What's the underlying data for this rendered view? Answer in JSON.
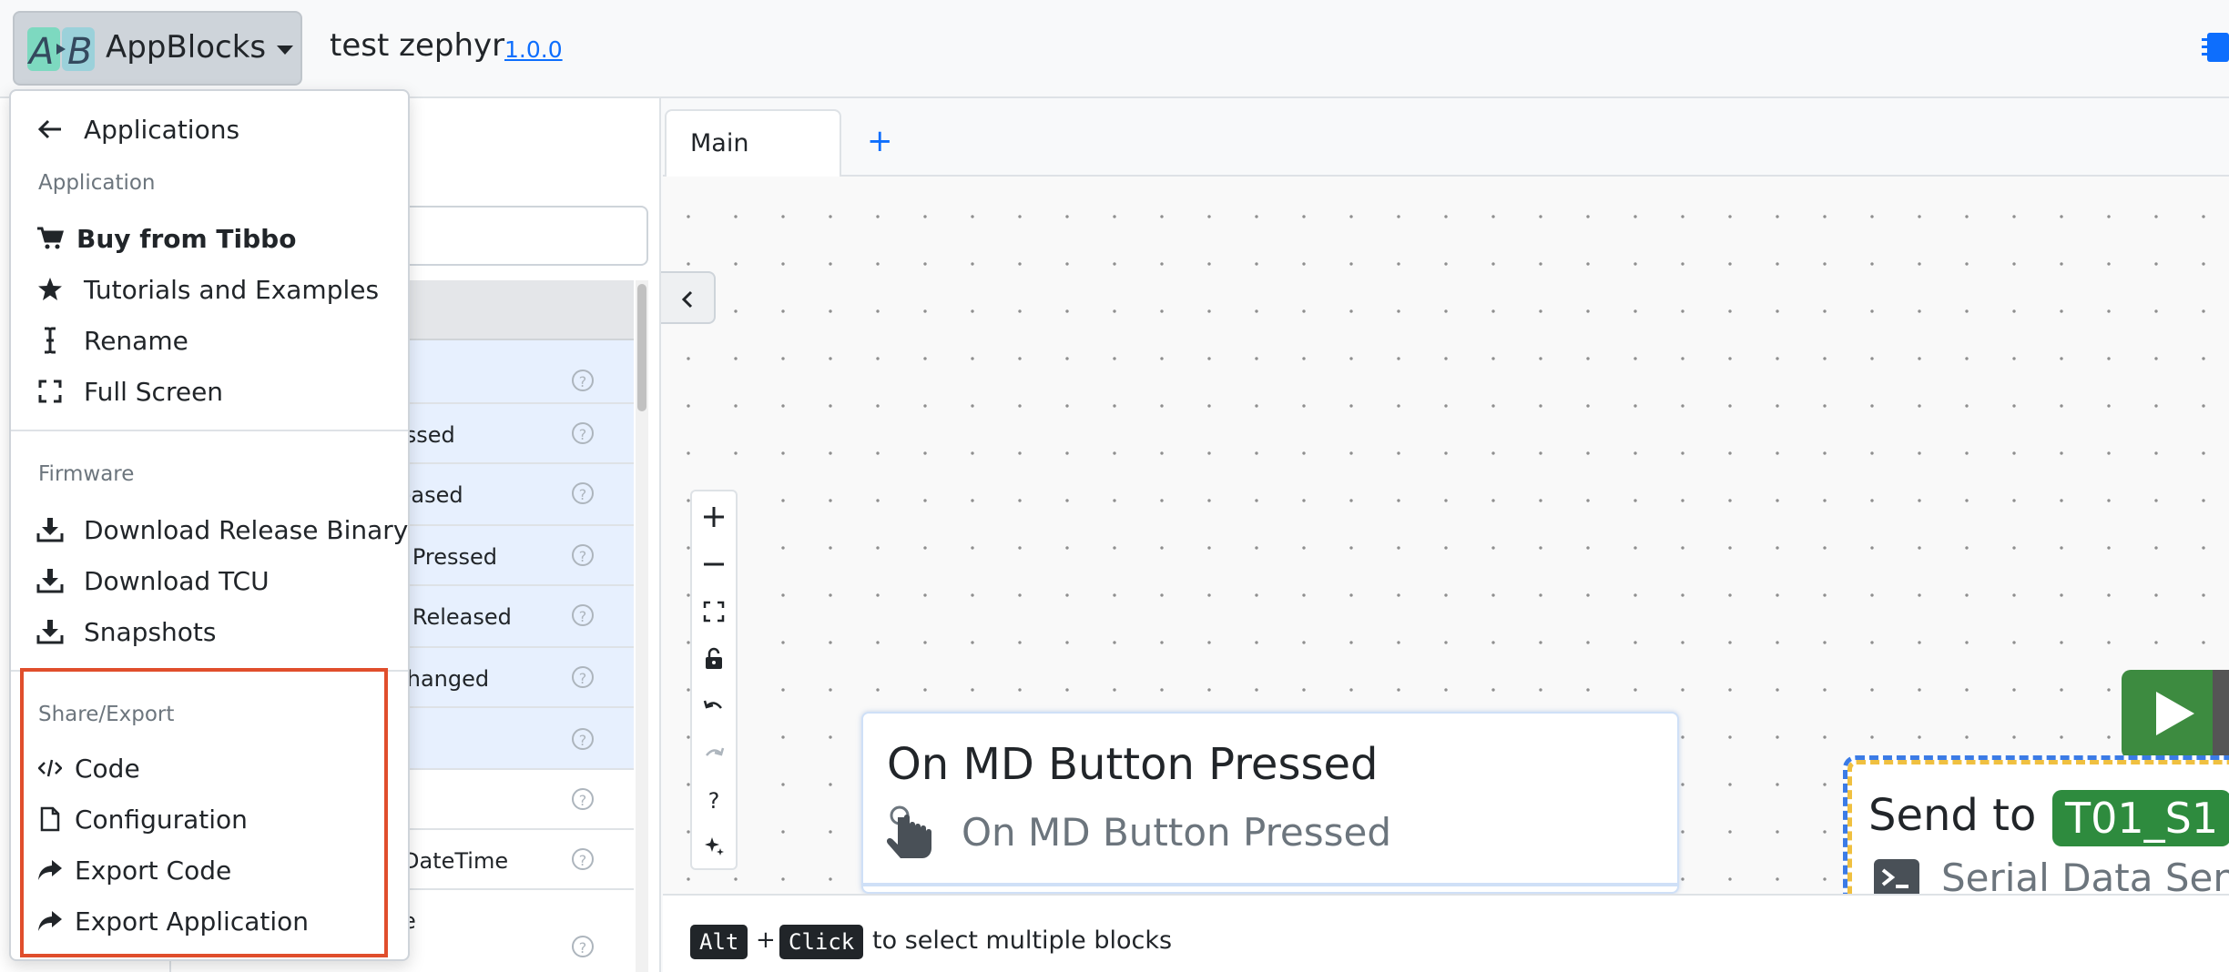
{
  "header": {
    "brand_label": "AppBlocks",
    "logo_text": "AB",
    "app_title": "test zephyr",
    "app_version": "1.0.0"
  },
  "menu": {
    "applications": "Applications",
    "application_section": "Application",
    "buy": "Buy from Tibbo",
    "tutorials": "Tutorials and Examples",
    "rename": "Rename",
    "fullscreen": "Full Screen",
    "firmware_section": "Firmware",
    "download_release": "Download Release Binary",
    "download_tcu": "Download TCU",
    "snapshots": "Snapshots",
    "share_section": "Share/Export",
    "code": "Code",
    "configuration": "Configuration",
    "export_code": "Export Code",
    "export_application": "Export Application"
  },
  "block_list": {
    "rows": [
      "",
      "essed",
      "leased",
      "n Pressed",
      "n Released",
      "Changed",
      "",
      "",
      "DateTime",
      "e"
    ],
    "help_symbol": "?"
  },
  "canvas": {
    "tabs": [
      "Main"
    ],
    "add_tab": "+",
    "block_title": "On MD Button Pressed",
    "block_subtitle": "On MD Button Pressed",
    "send_title": "Send to",
    "send_badge": "T01_S1",
    "send_subtitle": "Serial Data Sen"
  },
  "zoom_toolbar": {
    "help": "?"
  },
  "hint": {
    "key1": "Alt",
    "plus": "+",
    "key2": "Click",
    "text": "to select multiple blocks"
  },
  "colors": {
    "accent": "#0d6efd",
    "highlight": "#e04e2c",
    "run_green": "#3d8b40",
    "badge_green": "#2e8b3e"
  }
}
